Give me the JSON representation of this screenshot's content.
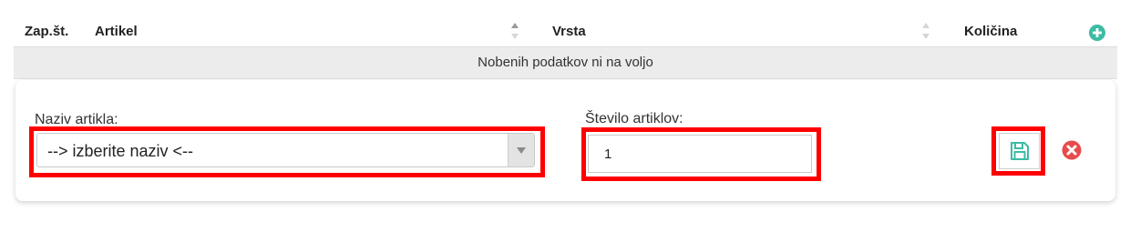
{
  "table": {
    "columns": {
      "index": "Zap.št.",
      "article": "Artikel",
      "type": "Vrsta",
      "quantity": "Količina"
    },
    "empty_message": "Nobenih podatkov ni na voljo"
  },
  "form": {
    "article_label": "Naziv artikla:",
    "article_selected": "--> izberite naziv <--",
    "quantity_label": "Število artiklov:",
    "quantity_value": "1"
  },
  "icons": {
    "add": "plus-circle-icon",
    "save": "floppy-disk-icon",
    "cancel": "x-circle-icon",
    "sort": "sort-icon",
    "dropdown": "chevron-down-icon"
  },
  "colors": {
    "accent_teal": "#3dbba4",
    "cancel_red": "#e74c4c",
    "highlight_red": "#ff0000",
    "empty_row_bg": "#ececec"
  }
}
